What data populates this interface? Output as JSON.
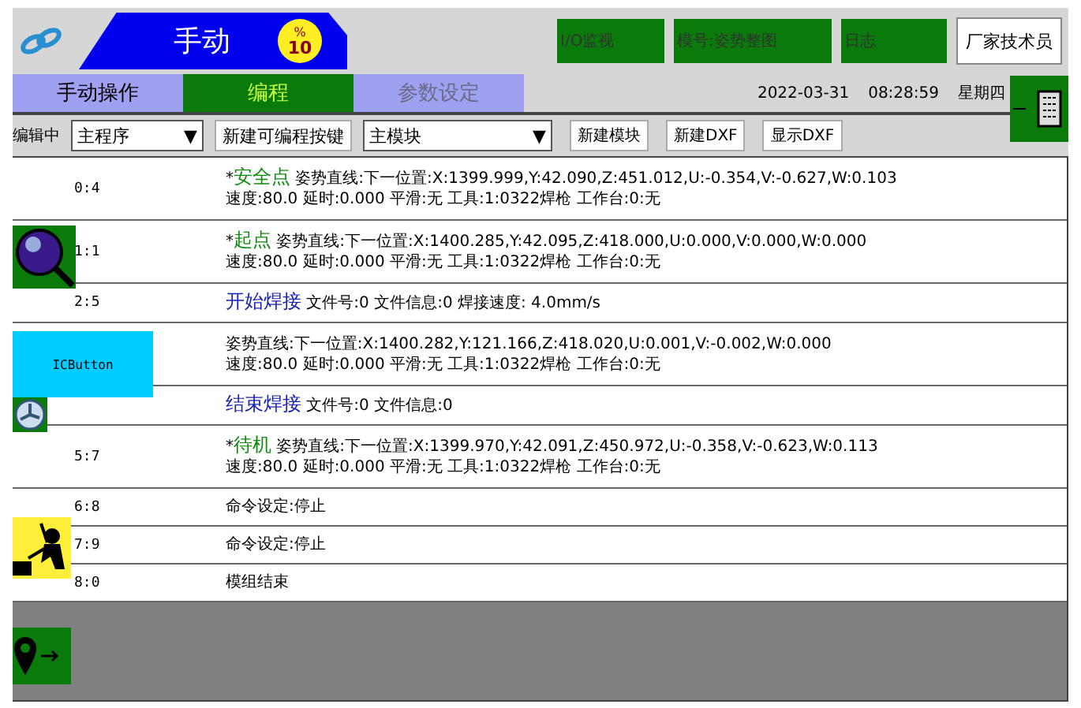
{
  "header": {
    "mode": {
      "title": "手动",
      "badge_symbol": "%",
      "badge_value": "10"
    },
    "buttons": [
      {
        "label": "I/O监视",
        "kind": "green"
      },
      {
        "label": "模号:姿势整图",
        "kind": "green"
      },
      {
        "label": "日志",
        "kind": "green"
      },
      {
        "label": "厂家技术员",
        "kind": "white"
      }
    ]
  },
  "tabs": [
    {
      "label": "手动操作",
      "selected": false,
      "disabled": false
    },
    {
      "label": "编程",
      "selected": true,
      "disabled": false
    },
    {
      "label": "参数设定",
      "selected": false,
      "disabled": true
    }
  ],
  "datetime": {
    "date": "2022-03-31",
    "time": "08:28:59",
    "weekday": "星期四"
  },
  "toolbar": [
    {
      "kind": "label",
      "text": "编辑中"
    },
    {
      "kind": "select",
      "text": "主程序",
      "caret": "▼"
    },
    {
      "kind": "button",
      "text": "新建可编程按键"
    },
    {
      "kind": "select",
      "text": "主模块",
      "caret": "▼"
    },
    {
      "kind": "button",
      "text": "新建模块"
    },
    {
      "kind": "button",
      "text": "新建DXF"
    },
    {
      "kind": "button",
      "text": "显示DXF"
    }
  ],
  "rows": [
    {
      "index": "0:4",
      "kind": "point",
      "marker": "*",
      "title": "安全点",
      "lines": [
        "姿势直线:下一位置:X:1399.999,Y:42.090,Z:451.012,U:-0.354,V:-0.627,W:0.103",
        "速度:80.0 延时:0.000 平滑:无 工具:1:0322焊枪 工作台:0:无"
      ]
    },
    {
      "index": "1:1",
      "kind": "point",
      "marker": "*",
      "title": "起点",
      "lines": [
        "姿势直线:下一位置:X:1400.285,Y:42.095,Z:418.000,U:0.000,V:0.000,W:0.000",
        "速度:80.0 延时:0.000 平滑:无 工具:1:0322焊枪 工作台:0:无"
      ]
    },
    {
      "index": "2:5",
      "kind": "weld",
      "title": "开始焊接",
      "lines": [
        "文件号:0 文件信息:0 焊接速度: 4.0mm/s"
      ]
    },
    {
      "kind": "point",
      "lines": [
        "姿势直线:下一位置:X:1400.282,Y:121.166,Z:418.020,U:0.001,V:-0.002,W:0.000",
        "速度:80.0 延时:0.000 平滑:无 工具:1:0322焊枪 工作台:0:无"
      ]
    },
    {
      "kind": "weld",
      "title": "结束焊接",
      "lines": [
        "文件号:0 文件信息:0"
      ]
    },
    {
      "index": "5:7",
      "kind": "point",
      "marker": "*",
      "title": "待机",
      "lines": [
        "姿势直线:下一位置:X:1399.970,Y:42.091,Z:450.972,U:-0.358,V:-0.623,W:0.113",
        "速度:80.0 延时:0.000 平滑:无 工具:1:0322焊枪 工作台:0:无"
      ]
    },
    {
      "index": "6:8",
      "kind": "plain",
      "lines": [
        "命令设定:停止"
      ]
    },
    {
      "index": "7:9",
      "kind": "plain",
      "lines": [
        "命令设定:停止"
      ]
    },
    {
      "index": "8:0",
      "kind": "plain",
      "lines": [
        "模组结束"
      ]
    }
  ],
  "ic_button": {
    "label": "ICButton"
  }
}
